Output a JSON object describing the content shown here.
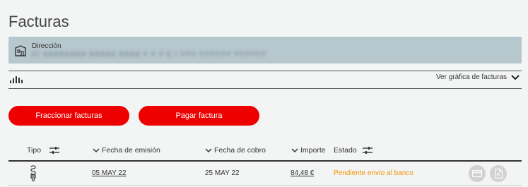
{
  "page": {
    "title": "Facturas"
  },
  "address": {
    "label": "Dirección",
    "value": "C/ XXXXXXXX XXXXX XXXX Y Y Y C / YYY YYYYYY YYYYYY"
  },
  "chart": {
    "toggle_label": "Ver gráfica de facturas"
  },
  "actions": {
    "fraccionar_label": "Fraccionar facturas",
    "pagar_label": "Pagar factura"
  },
  "table": {
    "headers": {
      "tipo": "Tipo",
      "fecha_emision": "Fecha de emisión",
      "fecha_cobro": "Fecha de cobro",
      "importe": "Importe",
      "estado": "Estado"
    },
    "rows": [
      {
        "tipo_icon": "lightbulb-icon",
        "fecha_emision": "05 MAY 22",
        "fecha_cobro": "25 MAY 22",
        "importe": "84,48 €",
        "estado": "Pendiente envío al banco"
      }
    ]
  },
  "colors": {
    "brand": "#ec0000",
    "status_pending": "#f29400",
    "address_bg": "#b6c7cd"
  }
}
